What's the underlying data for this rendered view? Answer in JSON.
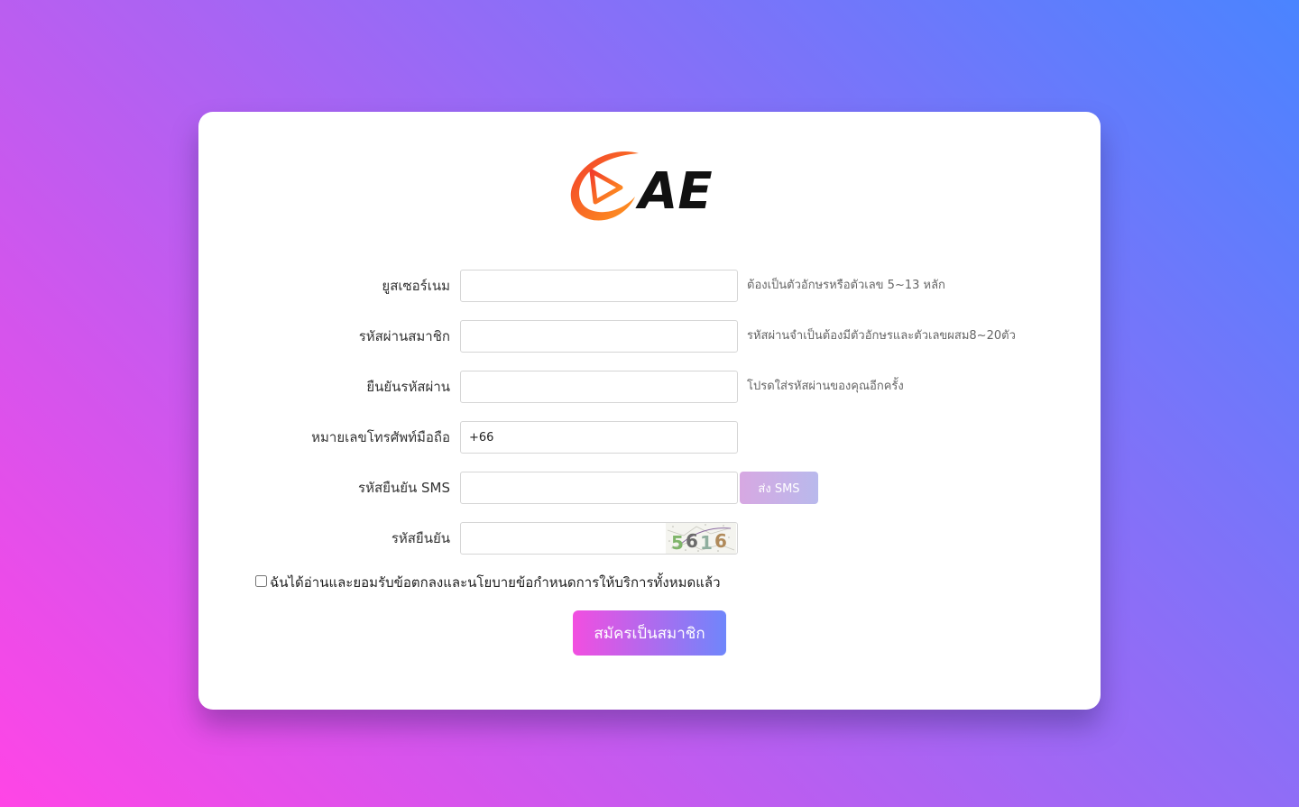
{
  "logo": {
    "text": "AE",
    "colors": {
      "swoosh_start": "#f23b2b",
      "swoosh_end": "#ff9a1f",
      "text": "#111111"
    }
  },
  "form": {
    "fields": [
      {
        "label": "ยูสเซอร์เนม",
        "value": "",
        "hint": "ต้องเป็นตัวอักษรหรือตัวเลข 5~13 หลัก"
      },
      {
        "label": "รหัสผ่านสมาชิก",
        "value": "",
        "hint": "รหัสผ่านจำเป็นต้องมีตัวอักษรและตัวเลขผสม8~20ตัว"
      },
      {
        "label": "ยืนยันรหัสผ่าน",
        "value": "",
        "hint": "โปรดใส่รหัสผ่านของคุณอีกครั้ง"
      },
      {
        "label": "หมายเลขโทรศัพท์มือถือ",
        "value": "+66",
        "hint": ""
      },
      {
        "label": "รหัสยืนยัน SMS",
        "value": "",
        "hint": ""
      },
      {
        "label": "รหัสยืนยัน",
        "value": "",
        "hint": ""
      }
    ],
    "sms_button": "ส่ง SMS",
    "captcha_code": "5616",
    "agree_text": "ฉันได้อ่านและยอมรับข้อตกลงและนโยบายข้อกำหนดการให้บริการทั้งหมดแล้ว",
    "agree_checked": false,
    "submit_label": "สมัครเป็นสมาชิก"
  },
  "colors": {
    "background_start": "#ff45e6",
    "background_end": "#4a84ff",
    "submit_start": "#f24ee0",
    "submit_end": "#6f86fb",
    "sms_start": "#d7a8e2",
    "sms_end": "#b9b9ec",
    "captcha_digits": [
      "#7fb56a",
      "#6b6b6b",
      "#8fae9e",
      "#b08a5a"
    ]
  }
}
